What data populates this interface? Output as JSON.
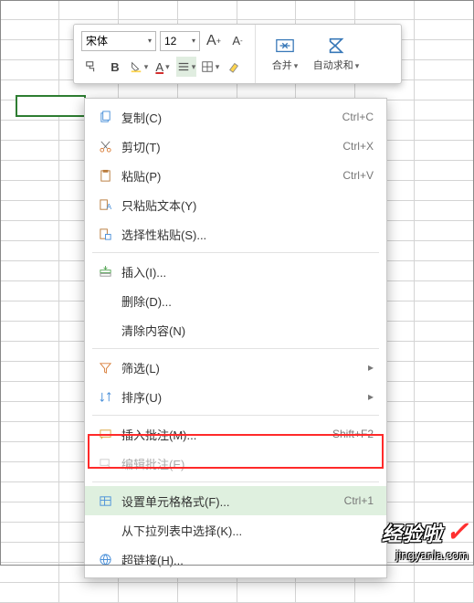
{
  "toolbar": {
    "font": "宋体",
    "size": "12",
    "inc_label": "A⁺",
    "dec_label": "A⁻",
    "bold": "B",
    "merge_label": "合并",
    "autosum_label": "自动求和"
  },
  "menu": {
    "items": [
      {
        "icon": "copy",
        "label": "复制(C)",
        "shortcut": "Ctrl+C",
        "bind": "m0"
      },
      {
        "icon": "cut",
        "label": "剪切(T)",
        "shortcut": "Ctrl+X",
        "bind": "m1"
      },
      {
        "icon": "paste",
        "label": "粘贴(P)",
        "shortcut": "Ctrl+V",
        "bind": "m2"
      },
      {
        "icon": "paste-text",
        "label": "只粘贴文本(Y)",
        "shortcut": "",
        "bind": "m3"
      },
      {
        "icon": "paste-special",
        "label": "选择性粘贴(S)...",
        "shortcut": "",
        "bind": "m4"
      },
      {
        "sep": true
      },
      {
        "icon": "insert",
        "label": "插入(I)...",
        "shortcut": "",
        "bind": "m5"
      },
      {
        "icon": "",
        "label": "删除(D)...",
        "shortcut": "",
        "bind": "m6"
      },
      {
        "icon": "",
        "label": "清除内容(N)",
        "shortcut": "",
        "bind": "m7"
      },
      {
        "sep": true
      },
      {
        "icon": "filter",
        "label": "筛选(L)",
        "shortcut": "",
        "sub": true,
        "bind": "m8"
      },
      {
        "icon": "sort",
        "label": "排序(U)",
        "shortcut": "",
        "sub": true,
        "bind": "m9"
      },
      {
        "sep": true
      },
      {
        "icon": "comment",
        "label": "插入批注(M)...",
        "shortcut": "Shift+F2",
        "bind": "m10"
      },
      {
        "icon": "edit-comment",
        "label": "编辑批注(E)...",
        "shortcut": "",
        "disabled": true,
        "bind": "m11"
      },
      {
        "sep": true
      },
      {
        "icon": "format",
        "label": "设置单元格格式(F)...",
        "shortcut": "Ctrl+1",
        "hl": true,
        "bind": "m12"
      },
      {
        "icon": "",
        "label": "从下拉列表中选择(K)...",
        "shortcut": "",
        "bind": "m13"
      },
      {
        "icon": "link",
        "label": "超链接(H)...",
        "shortcut": "",
        "bind": "m14"
      }
    ]
  },
  "labels": {
    "m0": "复制(C)",
    "s0": "Ctrl+C",
    "m1": "剪切(T)",
    "s1": "Ctrl+X",
    "m2": "粘贴(P)",
    "s2": "Ctrl+V",
    "m3": "只粘贴文本(Y)",
    "s3": "",
    "m4": "选择性粘贴(S)...",
    "s4": "",
    "m5": "插入(I)...",
    "s5": "",
    "m6": "删除(D)...",
    "s6": "",
    "m7": "清除内容(N)",
    "s7": "",
    "m8": "筛选(L)",
    "s8": "",
    "m9": "排序(U)",
    "s9": "",
    "m10": "插入批注(M)...",
    "s10": "Shift+F2",
    "m11": "编辑批注(E)...",
    "s11": "",
    "m12": "设置单元格格式(F)...",
    "s12": "Ctrl+1",
    "m13": "从下拉列表中选择(K)...",
    "s13": "",
    "m14": "超链接(H)...",
    "s14": ""
  },
  "watermark": {
    "title": "经验啦",
    "url": "jingyanla.com"
  },
  "colors": {
    "accent": "#2e7d32",
    "highlightRow": "#dff0df",
    "redbox": "#ff2a2a"
  }
}
